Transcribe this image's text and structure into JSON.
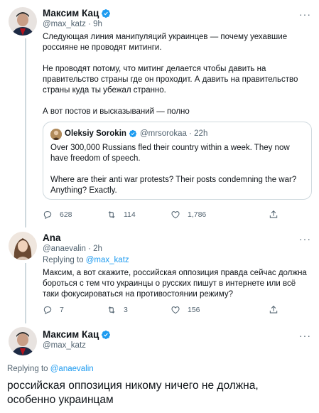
{
  "tweet1": {
    "display_name": "Максим Кац",
    "handle_time": "@max_katz · 9h",
    "text": "Следующая линия манипуляций украинцев — почему уехавшие россияне не проводят митинги.\n\nНе проводят потому, что митинг делается чтобы давить на правительство страны где он проходит. А давить на правительство страны куда ты убежал странно.\n\nА вот постов и высказываний — полно",
    "quote": {
      "name": "Oleksiy Sorokin",
      "handle_time": "@mrsorokaa · 22h",
      "text": "Over 300,000 Russians fled their country within a week. They now have freedom of speech.\n\nWhere are their anti war protests? Their posts condemning the war? Anything? Exactly."
    },
    "replies": "628",
    "retweets": "114",
    "likes": "1,786"
  },
  "tweet2": {
    "display_name": "Ana",
    "handle_time": "@anaevalin · 2h",
    "replying_prefix": "Replying to",
    "replying_handle": "@max_katz",
    "text": "Максим, а вот скажите, российская оппозиция правда сейчас должна бороться с тем что украинцы о русских пишут в интернете или всё таки фокусироваться на противостоянии режиму?",
    "replies": "7",
    "retweets": "3",
    "likes": "156"
  },
  "tweet3": {
    "display_name": "Максим Кац",
    "handle": "@max_katz",
    "replying_prefix": "Replying to",
    "replying_handle": "@anaevalin",
    "text": "российская оппозиция никому ничего не должна,\nособенно украинцам"
  },
  "more_label": "···",
  "colors": {
    "accent": "#1d9bf0",
    "muted": "#536471",
    "border": "#cfd9de"
  }
}
